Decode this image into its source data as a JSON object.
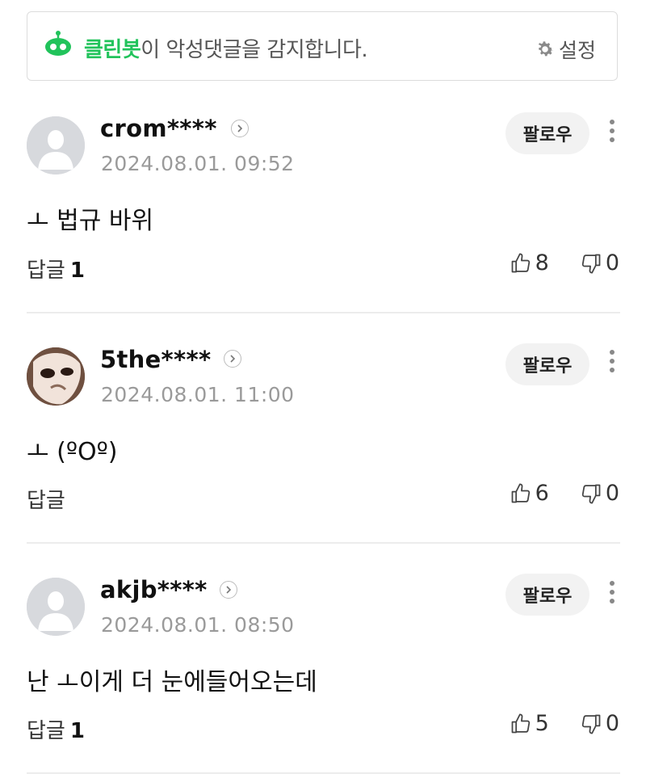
{
  "banner": {
    "brand": "클린봇",
    "message": "이 악성댓글을 감지합니다.",
    "settings_label": "설정",
    "brand_color": "#21c35b"
  },
  "comments": [
    {
      "username": "crom****",
      "date": "2024.08.01. 09:52",
      "follow_label": "팔로우",
      "text": "ㅗ 법규 바위",
      "reply_label": "답글",
      "reply_count": "1",
      "likes": "8",
      "dislikes": "0",
      "avatar": "default-avatar"
    },
    {
      "username": "5the****",
      "date": "2024.08.01. 11:00",
      "follow_label": "팔로우",
      "text": "ㅗ (ºOº)",
      "reply_label": "답글",
      "reply_count": "",
      "likes": "6",
      "dislikes": "0",
      "avatar": "photo-avatar"
    },
    {
      "username": "akjb****",
      "date": "2024.08.01. 08:50",
      "follow_label": "팔로우",
      "text": "난 ㅗ이게 더 눈에들어오는데",
      "reply_label": "답글",
      "reply_count": "1",
      "likes": "5",
      "dislikes": "0",
      "avatar": "default-avatar"
    }
  ]
}
